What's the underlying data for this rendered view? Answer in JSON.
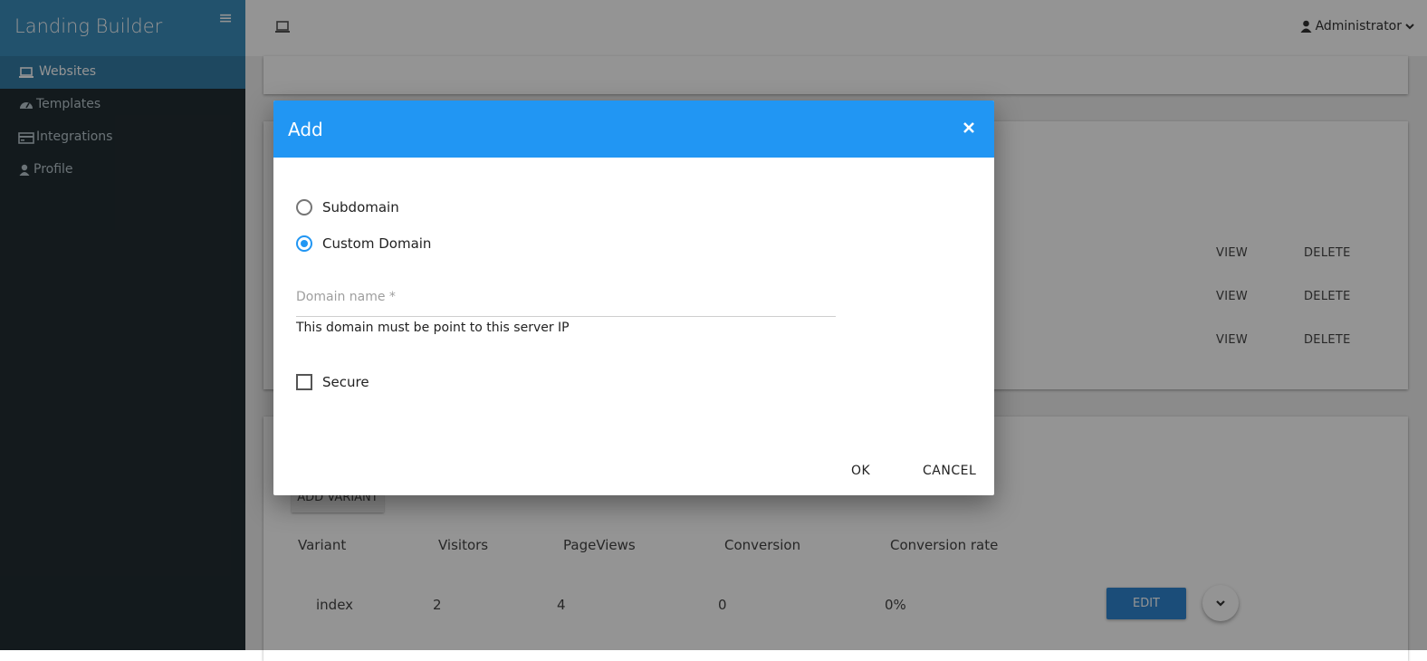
{
  "sidebar": {
    "brand": "Landing Builder",
    "items": [
      {
        "label": "Websites",
        "icon": "laptop-icon",
        "active": true
      },
      {
        "label": "Templates",
        "icon": "dashboard-icon",
        "active": false
      },
      {
        "label": "Integrations",
        "icon": "credit-card-icon",
        "active": false
      },
      {
        "label": "Profile",
        "icon": "user-icon",
        "active": false
      }
    ]
  },
  "topbar": {
    "user": "Administrator"
  },
  "background": {
    "row_actions": [
      {
        "view": "VIEW",
        "delete": "DELETE"
      },
      {
        "view": "VIEW",
        "delete": "DELETE"
      },
      {
        "view": "VIEW",
        "delete": "DELETE"
      }
    ],
    "add_variant": "ADD VARIANT",
    "table": {
      "headers": [
        "Variant",
        "Visitors",
        "PageViews",
        "Conversion",
        "Conversion rate"
      ],
      "row": [
        "index",
        "2",
        "4",
        "0",
        "0%"
      ]
    },
    "edit": "EDIT"
  },
  "modal": {
    "title": "Add",
    "options": [
      {
        "label": "Subdomain",
        "checked": false
      },
      {
        "label": "Custom Domain",
        "checked": true
      }
    ],
    "domain_placeholder": "Domain name *",
    "domain_value": "",
    "helper": "This domain must be point to this server IP",
    "secure_label": "Secure",
    "secure_checked": false,
    "ok": "OK",
    "cancel": "CANCEL"
  },
  "colors": {
    "sidebar_bg": "#222d32",
    "brand_bg": "#3c8dbc",
    "active_item_bg": "#357ca5",
    "modal_header": "#2196f3",
    "edit_button": "#2f86d1"
  }
}
